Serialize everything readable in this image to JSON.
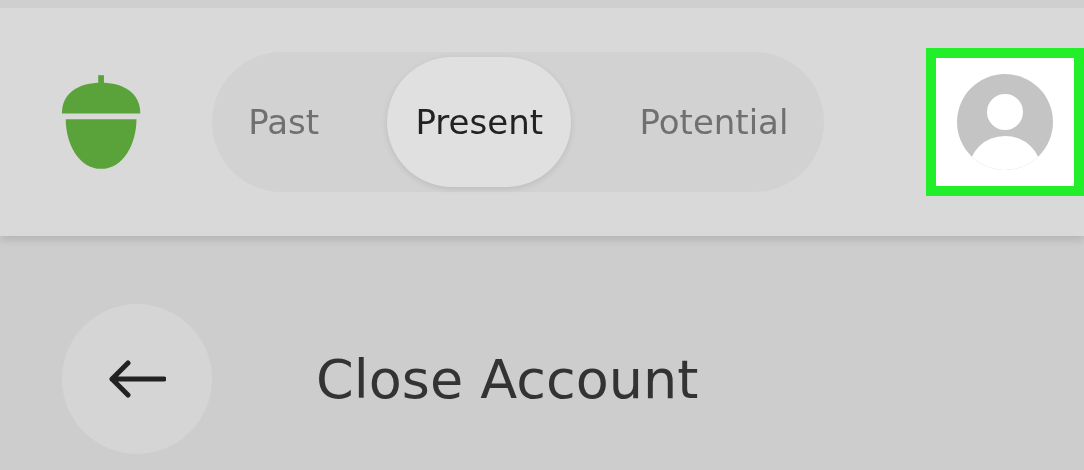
{
  "tabs": [
    {
      "label": "Past",
      "selected": false
    },
    {
      "label": "Present",
      "selected": true
    },
    {
      "label": "Potential",
      "selected": false
    }
  ],
  "profile": {
    "highlighted": true
  },
  "page": {
    "title": "Close Account"
  }
}
